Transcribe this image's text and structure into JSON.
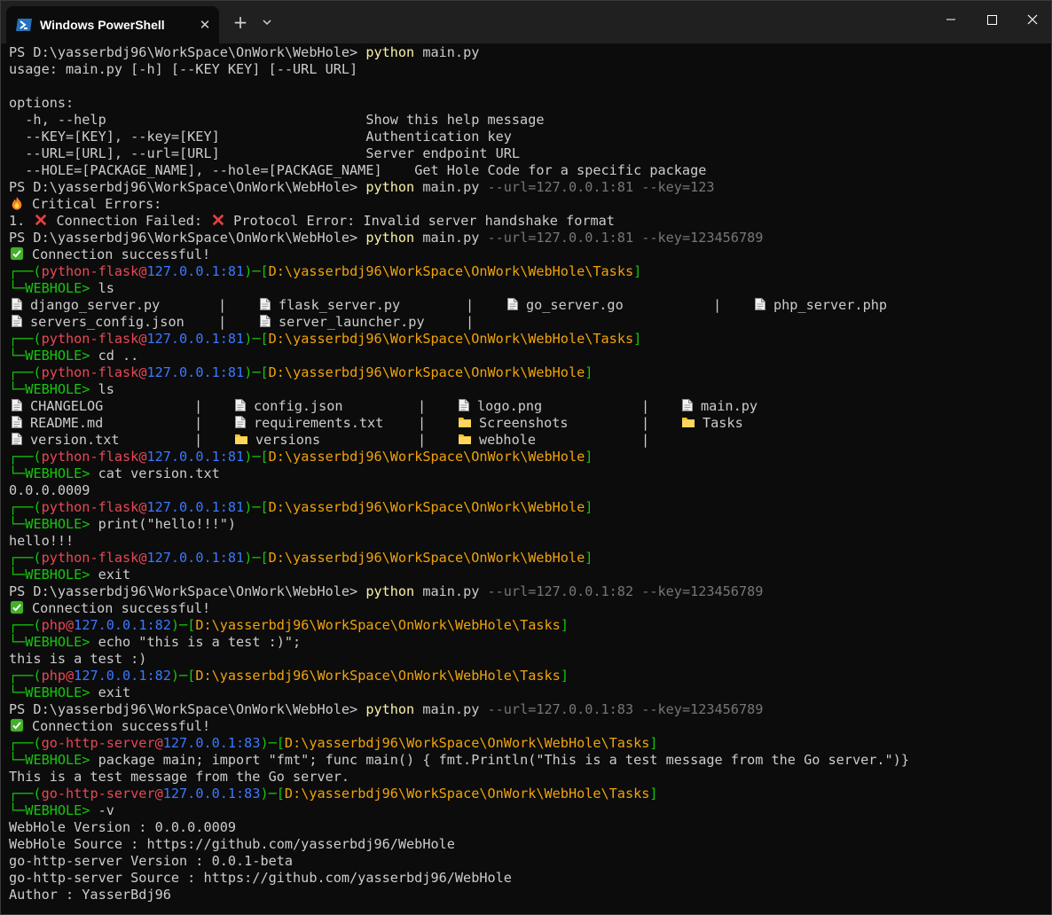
{
  "window": {
    "tab_title": "Windows PowerShell",
    "new_tab_label": "+",
    "close_tab_label": "✕"
  },
  "colors": {
    "background": "#0c0c0c",
    "titlebar": "#202020",
    "command": "#f9f1a5",
    "param": "#767676",
    "green": "#16c60c",
    "red": "#e74856",
    "blue": "#3b78ff",
    "orange": "#f0a30a"
  },
  "terminal": {
    "prompt": "PS D:\\yasserbdj96\\WorkSpace\\OnWork\\WebHole> ",
    "cmd_python": "python",
    "cmd_main": " main.py",
    "usage": "usage: main.py [-h] [--KEY KEY] [--URL URL]",
    "options_header": "options:",
    "options": [
      {
        "flag": "  -h, --help                                ",
        "desc": "Show this help message"
      },
      {
        "flag": "  --KEY=[KEY], --key=[KEY]                  ",
        "desc": "Authentication key"
      },
      {
        "flag": "  --URL=[URL], --url=[URL]                  ",
        "desc": "Server endpoint URL"
      },
      {
        "flag": "  --HOLE=[PACKAGE_NAME], --hole=[PACKAGE_NAME]    ",
        "desc": "Get Hole Code for a specific package"
      }
    ],
    "args_1": " --url=127.0.0.1:81 --key=123",
    "critical_errors": "Critical Errors:",
    "error_num": "1. ",
    "error_a": "Connection Failed: ",
    "error_b": "Protocol Error: Invalid server handshake format",
    "args_2": " --url=127.0.0.1:81 --key=123456789",
    "args_3": " --url=127.0.0.1:82 --key=123456789",
    "args_4": " --url=127.0.0.1:83 --key=123456789",
    "conn_ok": "Connection successful!",
    "box_top": "┌──(",
    "box_mid": ")─[",
    "box_end": "]",
    "box_bottom": "└─",
    "webhole": "WEBHOLE> ",
    "at": "@",
    "srv_flask": "python-flask",
    "srv_php": "php",
    "srv_go": "go-http-server",
    "host_81": "127.0.0.1:81",
    "host_82": "127.0.0.1:82",
    "host_83": "127.0.0.1:83",
    "path_tasks": "D:\\yasserbdj96\\WorkSpace\\OnWork\\WebHole\\Tasks",
    "path_root": "D:\\yasserbdj96\\WorkSpace\\OnWork\\WebHole",
    "cmd_ls": "ls",
    "cmd_cd": "cd ..",
    "cmd_cat": "cat version.txt",
    "cmd_print": "print(\"hello!!!\")",
    "cmd_exit": "exit",
    "cmd_echo": "echo \"this is a test :)\";",
    "cmd_go": "package main; import \"fmt\"; func main() { fmt.Println(\"This is a test message from the Go server.\")}",
    "cmd_v": "-v",
    "sep": "|",
    "ls1": [
      {
        "name": "django_server.py",
        "type": "file"
      },
      {
        "name": "flask_server.py",
        "type": "file"
      },
      {
        "name": "go_server.go",
        "type": "file"
      },
      {
        "name": "php_server.php",
        "type": "file"
      },
      {
        "name": "servers_config.json",
        "type": "file"
      },
      {
        "name": "server_launcher.py",
        "type": "file"
      }
    ],
    "ls2": [
      {
        "name": "CHANGELOG",
        "type": "file"
      },
      {
        "name": "config.json",
        "type": "file"
      },
      {
        "name": "logo.png",
        "type": "file"
      },
      {
        "name": "main.py",
        "type": "file"
      },
      {
        "name": "README.md",
        "type": "file"
      },
      {
        "name": "requirements.txt",
        "type": "file"
      },
      {
        "name": "Screenshots",
        "type": "folder"
      },
      {
        "name": "Tasks",
        "type": "folder"
      },
      {
        "name": "version.txt",
        "type": "file"
      },
      {
        "name": "versions",
        "type": "folder"
      },
      {
        "name": "webhole",
        "type": "folder"
      }
    ],
    "out_version": "0.0.0.0009",
    "out_hello": "hello!!!",
    "out_test": "this is a test :)",
    "out_go": "This is a test message from the Go server.",
    "info": [
      "WebHole Version : 0.0.0.0009",
      "WebHole Source : https://github.com/yasserbdj96/WebHole",
      "go-http-server Version : 0.0.1-beta",
      "go-http-server Source : https://github.com/yasserbdj96/WebHole",
      "Author : YasserBdj96"
    ]
  }
}
